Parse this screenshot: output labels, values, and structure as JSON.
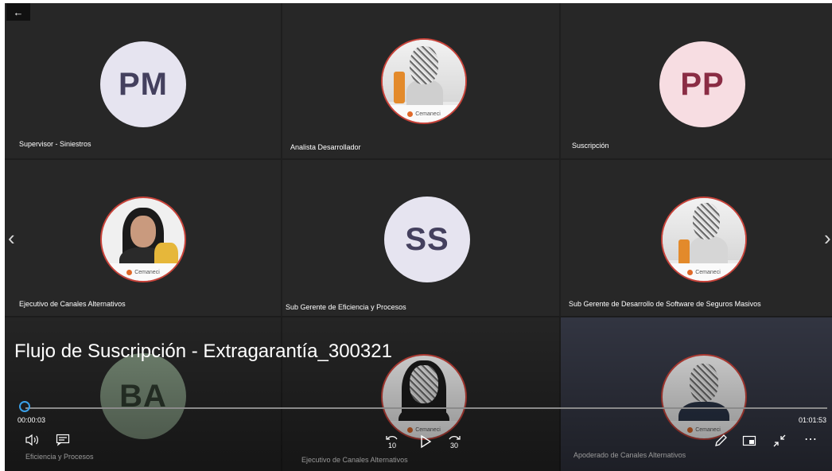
{
  "player": {
    "title": "Flujo de Suscripción - Extragarantía_300321",
    "current_time": "00:00:03",
    "duration": "01:01:53",
    "progress_fraction": 0.001,
    "skip_back_seconds": "10",
    "skip_forward_seconds": "30",
    "accent_color": "#3aa0e8"
  },
  "tiles": [
    {
      "initials": "PM",
      "label": "Supervisor - Siniestros"
    },
    {
      "initials": "",
      "label": "Analista Desarrollador"
    },
    {
      "initials": "PP",
      "label": "Suscripción"
    },
    {
      "initials": "",
      "label": "Ejecutivo de Canales Alternativos"
    },
    {
      "initials": "SS",
      "label": "Sub Gerente de Eficiencia y Procesos"
    },
    {
      "initials": "",
      "label": "Sub Gerente de Desarrollo de Software de Seguros Masivos"
    },
    {
      "initials": "BA",
      "label": "Eficiencia y Procesos"
    },
    {
      "initials": "",
      "label": "Ejecutivo de Canales Alternativos"
    },
    {
      "initials": "",
      "label": "Apoderado de Canales Alternativos"
    }
  ],
  "icons": {
    "back": "←",
    "prev": "‹",
    "next": "›",
    "volume": "speaker-icon",
    "captions": "captions-icon",
    "play": "play-icon",
    "edit": "pencil-icon",
    "pip": "picture-in-picture-icon",
    "exit_fullscreen": "exit-fullscreen-icon",
    "more": "⋯"
  },
  "photo_logo": "Cemaneci"
}
